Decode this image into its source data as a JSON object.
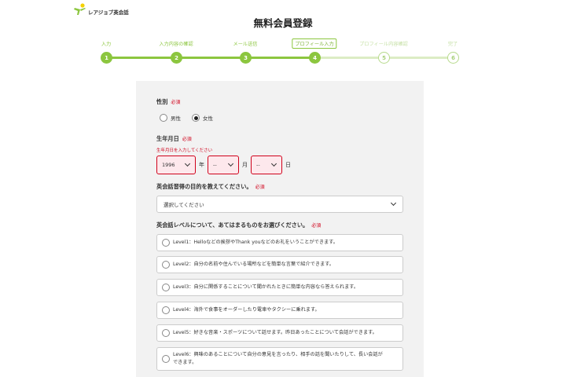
{
  "brand": {
    "name": "レアジョブ英会話",
    "accent": "#8cc63f"
  },
  "page": {
    "title": "無料会員登録"
  },
  "stepper": {
    "current": 4,
    "steps": [
      {
        "number": "1",
        "label": "入力",
        "state": "done"
      },
      {
        "number": "2",
        "label": "入力内容の確認",
        "state": "done"
      },
      {
        "number": "3",
        "label": "メール送信",
        "state": "done"
      },
      {
        "number": "4",
        "label": "プロフィール入力",
        "state": "current"
      },
      {
        "number": "5",
        "label": "プロフィール内容確認",
        "state": "todo"
      },
      {
        "number": "6",
        "label": "完了",
        "state": "todo"
      }
    ]
  },
  "form": {
    "required_label": "必須",
    "gender": {
      "label": "性別",
      "options": [
        {
          "label": "男性",
          "checked": false
        },
        {
          "label": "女性",
          "checked": true
        }
      ]
    },
    "birthdate": {
      "label": "生年月日",
      "hint": "生年月日を入力してください",
      "year_value": "1996",
      "year_unit": "年",
      "month_value": "--",
      "month_unit": "月",
      "day_value": "--",
      "day_unit": "日"
    },
    "purpose": {
      "label": "英会話習得の目的を教えてください。",
      "value": "選択してください"
    },
    "level": {
      "label": "英会話レベルについて、あてはまるものをお選びください。",
      "options": [
        "Level1：Helloなどの挨拶やThank youなどのお礼をいうことができます。",
        "Level2：自分の名前や住んでいる場所などを簡単な言葉で紹介できます。",
        "Level3：自分に関係することについて聞かれたときに簡単な内容なら答えられます。",
        "Level4：海外で食事をオーダーしたり電車やタクシーに乗れます。",
        "Level5：好きな音楽・スポーツについて話せます。昨日あったことについて会話ができます。",
        "Level6：興味のあることについて自分の意見を言ったり、相手の話を聞いたりして、長い会話ができます。"
      ]
    }
  }
}
